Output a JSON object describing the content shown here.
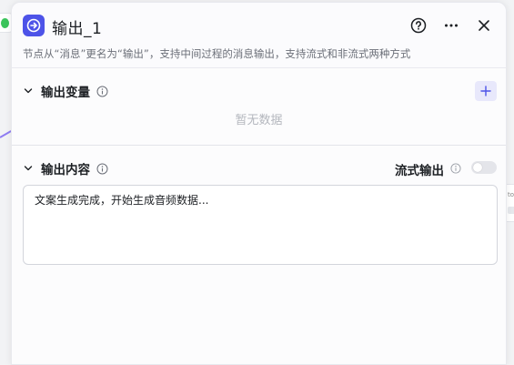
{
  "panel": {
    "title": "输出_1",
    "description": "节点从“消息”更名为“输出”，支持中间过程的消息输出，支持流式和非流式两种方式",
    "node_icon": "output-arrow-icon",
    "header_actions": [
      "help-icon",
      "more-icon",
      "close-icon"
    ]
  },
  "output_variables": {
    "title": "输出变量",
    "empty_text": "暂无数据",
    "add_icon": "plus-icon"
  },
  "output_content": {
    "title": "输出内容",
    "stream_label": "流式输出",
    "stream_enabled": false,
    "content": "文案生成完成，开始生成音频数据..."
  },
  "colors": {
    "accent": "#4d53e8",
    "toggle_off": "#e4e5ea",
    "muted_text": "#b4b7be"
  }
}
